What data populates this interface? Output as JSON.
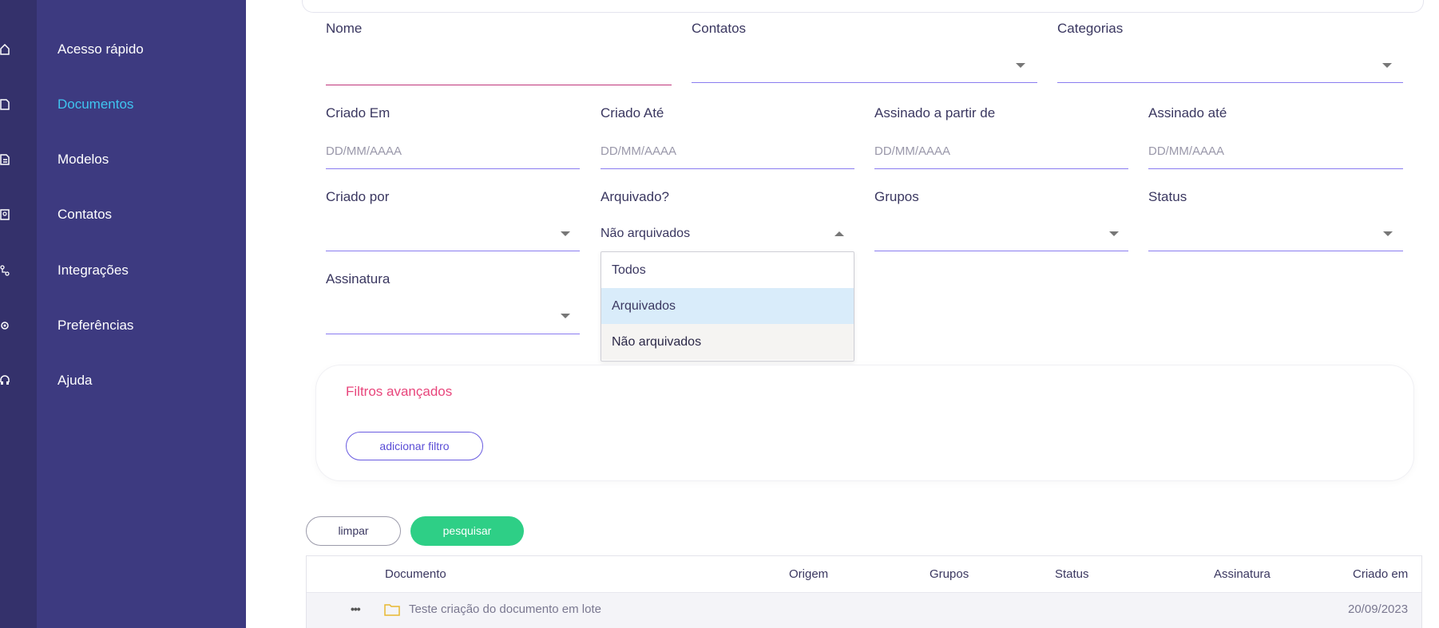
{
  "sidebar": {
    "items": [
      {
        "label": "Acesso rápido",
        "icon": "home-icon"
      },
      {
        "label": "Documentos",
        "icon": "document-icon",
        "active": true
      },
      {
        "label": "Modelos",
        "icon": "template-icon"
      },
      {
        "label": "Contatos",
        "icon": "contacts-icon"
      },
      {
        "label": "Integrações",
        "icon": "integrations-icon"
      },
      {
        "label": "Preferências",
        "icon": "gear-icon"
      },
      {
        "label": "Ajuda",
        "icon": "help-icon"
      }
    ],
    "active_color": "#3fc5f0",
    "background": "#3d3a80"
  },
  "filters": {
    "nome": {
      "label": "Nome",
      "value": ""
    },
    "contatos": {
      "label": "Contatos",
      "value": ""
    },
    "categorias": {
      "label": "Categorias",
      "value": ""
    },
    "criado_em": {
      "label": "Criado Em",
      "placeholder": "DD/MM/AAAA"
    },
    "criado_ate": {
      "label": "Criado Até",
      "placeholder": "DD/MM/AAAA"
    },
    "assinado_partir": {
      "label": "Assinado a partir de",
      "placeholder": "DD/MM/AAAA"
    },
    "assinado_ate": {
      "label": "Assinado até",
      "placeholder": "DD/MM/AAAA"
    },
    "criado_por": {
      "label": "Criado por",
      "value": ""
    },
    "arquivado": {
      "label": "Arquivado?",
      "value": "Não arquivados",
      "options": [
        "Todos",
        "Arquivados",
        "Não arquivados"
      ],
      "hovered": "Arquivados",
      "selected": "Não arquivados"
    },
    "grupos": {
      "label": "Grupos",
      "value": ""
    },
    "status": {
      "label": "Status",
      "value": ""
    },
    "assinatura": {
      "label": "Assinatura",
      "value": ""
    }
  },
  "advanced": {
    "title": "Filtros avançados",
    "add_label": "adicionar filtro"
  },
  "actions": {
    "clear_label": "limpar",
    "search_label": "pesquisar"
  },
  "table": {
    "columns": [
      "Documento",
      "Origem",
      "Grupos",
      "Status",
      "Assinatura",
      "Criado em"
    ],
    "rows": [
      {
        "documento": "Teste criação do documento em lote",
        "criado_em": "20/09/2023"
      }
    ]
  },
  "colors": {
    "accent_green": "#2ecf86",
    "accent_pink": "#e8467c",
    "accent_purple": "#6a5ce0"
  }
}
